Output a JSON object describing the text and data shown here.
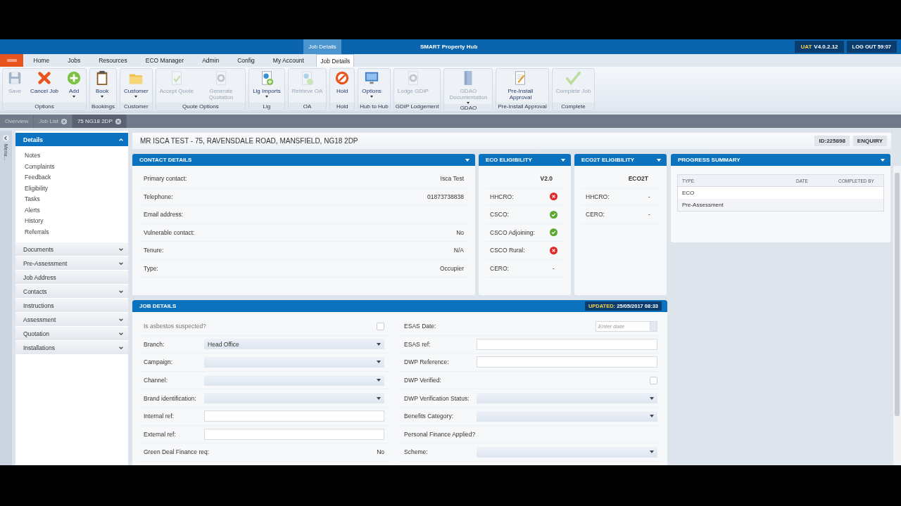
{
  "title_bar": {
    "context_tab": "Job Details",
    "title": "SMART Property Hub",
    "environment": "UAT",
    "version": "V4.0.2.12",
    "logout": "LOG OUT 59:07"
  },
  "menu_tabs": [
    {
      "label": "Home",
      "selected": false
    },
    {
      "label": "Jobs",
      "selected": false
    },
    {
      "label": "Resources",
      "selected": false
    },
    {
      "label": "ECO Manager",
      "selected": false
    },
    {
      "label": "Admin",
      "selected": false
    },
    {
      "label": "Config",
      "selected": false
    },
    {
      "label": "My Account",
      "selected": false
    },
    {
      "label": "Job Details",
      "selected": true
    }
  ],
  "ribbon": [
    {
      "group": "Options",
      "buttons": [
        {
          "label": "Save",
          "disabled": true,
          "dropdown": false
        },
        {
          "label": "Cancel Job",
          "disabled": false,
          "dropdown": false
        },
        {
          "label": "Add",
          "disabled": false,
          "dropdown": true
        }
      ]
    },
    {
      "group": "Bookings",
      "buttons": [
        {
          "label": "Book",
          "disabled": false,
          "dropdown": true
        }
      ]
    },
    {
      "group": "Customer",
      "buttons": [
        {
          "label": "Customer",
          "disabled": false,
          "dropdown": true
        }
      ]
    },
    {
      "group": "Quote Options",
      "buttons": [
        {
          "label": "Accept Quote",
          "disabled": true,
          "dropdown": false
        },
        {
          "label": "Generate Quotation",
          "disabled": true,
          "dropdown": false
        }
      ]
    },
    {
      "group": "Lig",
      "buttons": [
        {
          "label": "Lig Imports",
          "disabled": false,
          "dropdown": true
        }
      ]
    },
    {
      "group": "OA",
      "buttons": [
        {
          "label": "Retrieve OA",
          "disabled": true,
          "dropdown": false
        }
      ]
    },
    {
      "group": "Hold",
      "buttons": [
        {
          "label": "Hold",
          "disabled": false,
          "dropdown": false
        }
      ]
    },
    {
      "group": "Hub to Hub",
      "buttons": [
        {
          "label": "Options",
          "disabled": false,
          "dropdown": true
        }
      ]
    },
    {
      "group": "GDIP Lodgement",
      "buttons": [
        {
          "label": "Lodge GDIP",
          "disabled": true,
          "dropdown": false
        }
      ]
    },
    {
      "group": "GDAO",
      "buttons": [
        {
          "label": "GDAO Documentation",
          "disabled": true,
          "dropdown": true
        }
      ]
    },
    {
      "group": "Pre-Install Approval",
      "buttons": [
        {
          "label": "Pre-Install Approval",
          "disabled": false,
          "dropdown": false
        }
      ]
    },
    {
      "group": "Complete",
      "buttons": [
        {
          "label": "Complete Job",
          "disabled": true,
          "dropdown": false
        }
      ]
    }
  ],
  "document_tabs": [
    {
      "label": "Overview",
      "closable": false,
      "selected": false
    },
    {
      "label": "Job List",
      "closable": true,
      "selected": false
    },
    {
      "label": "75 NG18 2DP",
      "closable": true,
      "selected": true
    }
  ],
  "side_menu": {
    "label": "Menu...",
    "sections": [
      {
        "label": "Details",
        "kind": "group",
        "expanded": true,
        "children": [
          {
            "label": "Notes"
          },
          {
            "label": "Complaints"
          },
          {
            "label": "Feedback"
          },
          {
            "label": "Eligibility"
          },
          {
            "label": "Tasks"
          },
          {
            "label": "Alerts"
          },
          {
            "label": "History"
          },
          {
            "label": "Referrals"
          }
        ]
      },
      {
        "label": "Documents",
        "kind": "group",
        "expanded": false
      },
      {
        "label": "Pre-Assessment",
        "kind": "group",
        "expanded": false
      },
      {
        "label": "Job Address",
        "kind": "link"
      },
      {
        "label": "Contacts",
        "kind": "group",
        "expanded": false
      },
      {
        "label": "Instructions",
        "kind": "link"
      },
      {
        "label": "Assessment",
        "kind": "group",
        "expanded": false
      },
      {
        "label": "Quotation",
        "kind": "group",
        "expanded": false
      },
      {
        "label": "Installations",
        "kind": "group",
        "expanded": false
      }
    ]
  },
  "header": {
    "address": "MR ISCA  TEST - 75, RAVENSDALE ROAD, MANSFIELD, NG18 2DP",
    "id": "ID:225898",
    "status": "ENQUIRY"
  },
  "contact_details": {
    "title": "CONTACT DETAILS",
    "rows": [
      {
        "label": "Primary contact:",
        "value": "Isca  Test"
      },
      {
        "label": "Telephone:",
        "value": "01873738838"
      },
      {
        "label": "Email address:"
      },
      {
        "label": "Vulnerable contact:",
        "value": "No"
      },
      {
        "label": "Tenure:",
        "value": "N/A"
      },
      {
        "label": "Type:",
        "value": "Occupier"
      }
    ]
  },
  "eco_eligibility": {
    "title": "ECO ELIGIBILITY",
    "version": "V2.0",
    "rows": [
      {
        "label": "HHCRO:",
        "eligible": false
      },
      {
        "label": "CSCO:",
        "eligible": true
      },
      {
        "label": "CSCO Adjoining:",
        "eligible": true
      },
      {
        "label": "CSCO Rural:",
        "eligible": false
      },
      {
        "label": "CERO:",
        "value": "-"
      }
    ]
  },
  "eco2t_eligibility": {
    "title": "ECO2T ELIGIBILITY",
    "version": "ECO2T",
    "rows": [
      {
        "label": "HHCRO:",
        "value": "-"
      },
      {
        "label": "CERO:",
        "value": "-"
      }
    ]
  },
  "progress_summary": {
    "title": "PROGRESS SUMMARY",
    "columns": [
      "TYPE",
      "DATE",
      "COMPLETED BY"
    ],
    "rows": [
      {
        "type": "ECO"
      },
      {
        "type": "Pre-Assessment"
      }
    ]
  },
  "job_details": {
    "title": "JOB DETAILS",
    "updated_label": "UPDATED:",
    "updated": "25/05/2017 08:33",
    "left": [
      {
        "label": "Is asbestos suspected?",
        "kind": "checkbox",
        "checked": false
      },
      {
        "label": "Branch:",
        "kind": "select",
        "value": "Head Office"
      },
      {
        "label": "Campaign:",
        "kind": "select"
      },
      {
        "label": "Channel:",
        "kind": "select"
      },
      {
        "label": "Brand identification:",
        "kind": "select"
      },
      {
        "label": "Internal ref:",
        "kind": "input"
      },
      {
        "label": "External ref:",
        "kind": "input"
      },
      {
        "label": "Green Deal Finance req:",
        "kind": "text",
        "value": "No"
      }
    ],
    "right": [
      {
        "label": "ESAS Date:",
        "kind": "date",
        "placeholder": "Enter date"
      },
      {
        "label": "ESAS ref:",
        "kind": "input"
      },
      {
        "label": "DWP Reference:",
        "kind": "input"
      },
      {
        "label": "DWP Verified:",
        "kind": "checkbox",
        "checked": false
      },
      {
        "label": "DWP Verification Status:",
        "kind": "select"
      },
      {
        "label": "Benefits Category:",
        "kind": "select"
      },
      {
        "label": "Personal Finance Applied?",
        "kind": "label"
      },
      {
        "label": "Scheme:",
        "kind": "select"
      }
    ]
  }
}
